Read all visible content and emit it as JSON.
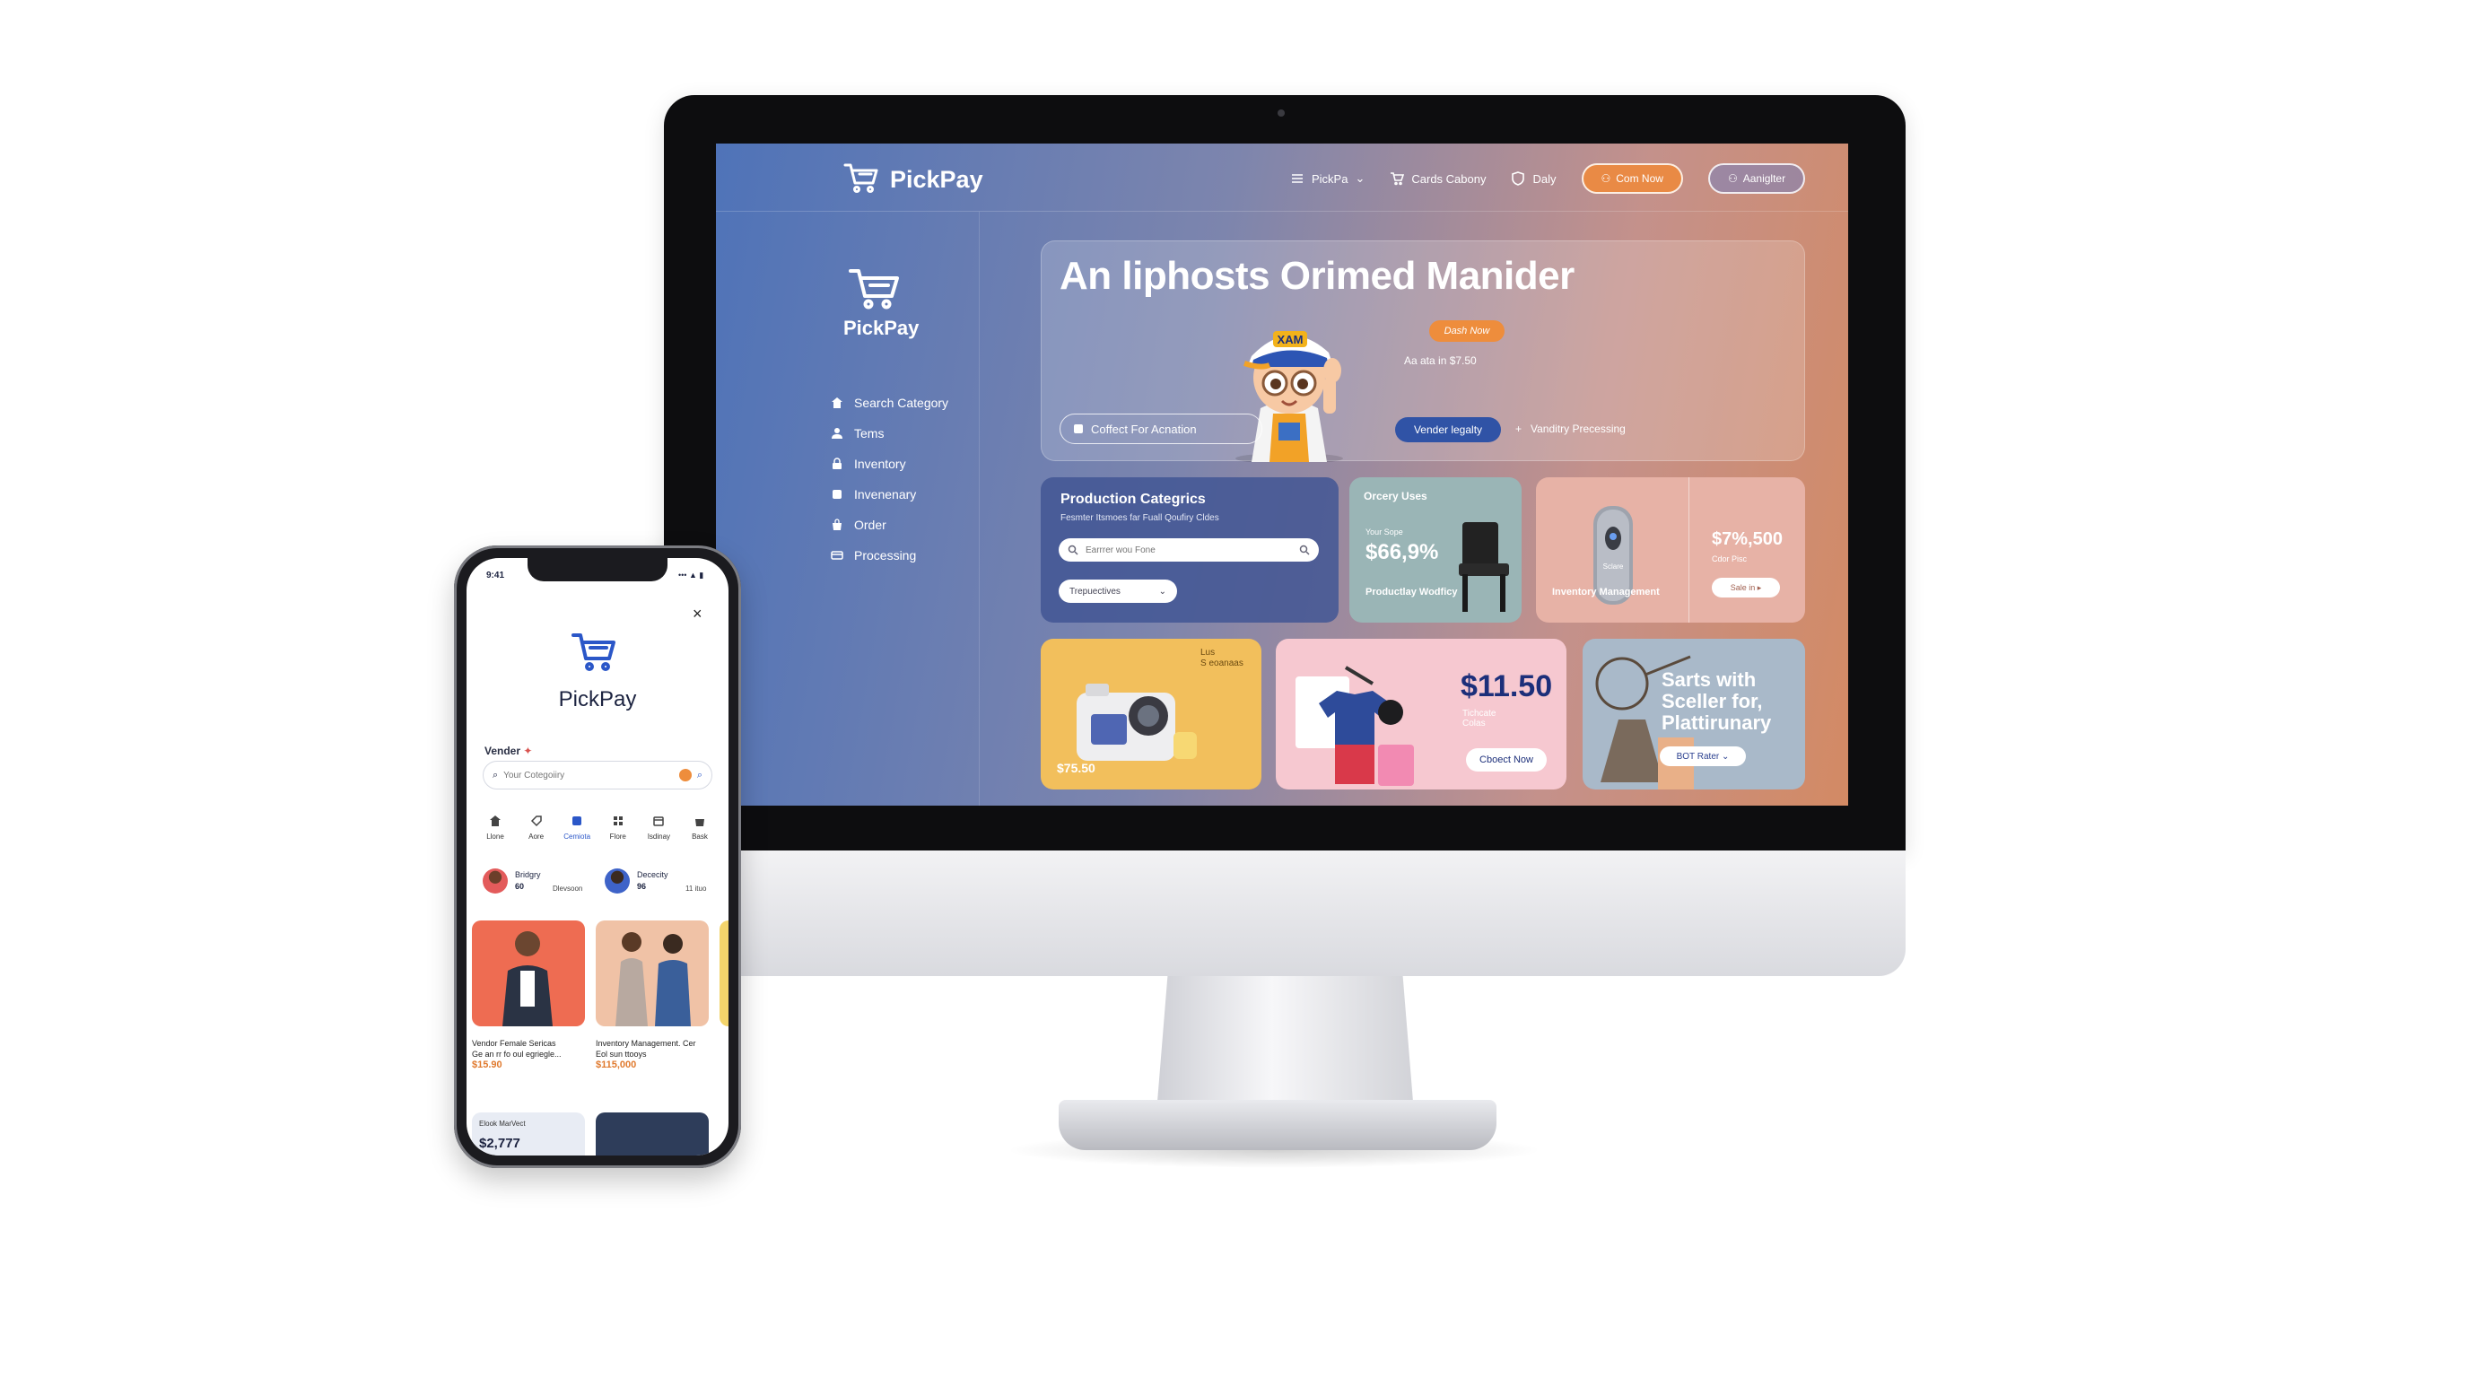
{
  "colors": {
    "accent_orange": "#ee8d3c",
    "accent_blue": "#3053a6",
    "brand_navy": "#1c2f7a",
    "screen_left": "#4f73b8",
    "screen_right": "#d38a64"
  },
  "desktop": {
    "brand": {
      "name": "PickPay",
      "icon": "cart-icon"
    },
    "nav": {
      "items": [
        {
          "label": "PickPa",
          "icon": "menu-icon"
        },
        {
          "label": "Cards Cabony",
          "icon": "cart-icon"
        },
        {
          "label": "Daly",
          "icon": "shield-icon"
        }
      ],
      "primary_button": "Com Now",
      "secondary_button": "Aaniglter"
    },
    "sidebar": {
      "brand": "PickPay",
      "items": [
        {
          "label": "Search Category",
          "icon": "home-icon"
        },
        {
          "label": "Tems",
          "icon": "user-icon"
        },
        {
          "label": "Inventory",
          "icon": "lock-icon"
        },
        {
          "label": "Invenenary",
          "icon": "box-icon"
        },
        {
          "label": "Order",
          "icon": "bag-icon"
        },
        {
          "label": "Processing",
          "icon": "card-icon"
        }
      ]
    },
    "hero": {
      "title": "An liphosts Orimed Manider",
      "badge": "Dash Now",
      "price_text": "Aa ata in $7.50",
      "pill_label": "Coffect For Acnation",
      "vendor_button": "Vender legalty",
      "link_label": "Vanditry Precessing"
    },
    "category_card": {
      "title": "Production Categrics",
      "subtitle": "Fesmter Itsmoes far Fuall Qoufiry Cldes",
      "search_placeholder": "Earrrer wou Fone",
      "select_value": "Trepuectives"
    },
    "grocery_card": {
      "title": "Orcery Uses",
      "small": "Your Sope",
      "value": "$66,9%",
      "footer": "Productlay Wodficy"
    },
    "inventory_card": {
      "label": "Inventory Management",
      "device_label": "Sclare",
      "value": "$7%,500",
      "sub": "Cdor Pisc",
      "button": "Sale in ▸"
    },
    "camera_card": {
      "badge": "Lus\nS eoanaas",
      "price": "$75.50"
    },
    "clothing_card": {
      "price": "$11.50",
      "sub": "Tichcate\nColas",
      "button": "Cboect Now"
    },
    "seller_card": {
      "text": "Sarts with\nSceller for,\nPlattirunary",
      "button": "BOT Rater ⌄"
    }
  },
  "mobile": {
    "status_time": "9:41",
    "status_icons": "••• ▲ ▮",
    "close_icon": "×",
    "brand": "PickPay",
    "vendor_label": "Vender",
    "search_placeholder": "Your Cotegoiiry",
    "tabs": [
      {
        "label": "Llone",
        "icon": "home-icon",
        "active": false
      },
      {
        "label": "Aore",
        "icon": "tag-icon",
        "active": false
      },
      {
        "label": "Cemiota",
        "icon": "chart-icon",
        "active": true
      },
      {
        "label": "Flore",
        "icon": "grid-icon",
        "active": false
      },
      {
        "label": "Isdinay",
        "icon": "calendar-icon",
        "active": false
      },
      {
        "label": "Bask",
        "icon": "bag-icon",
        "active": false
      }
    ],
    "people": [
      {
        "name": "Bridgry",
        "count": "60",
        "meta": "Dlevsoon"
      },
      {
        "name": "Dececity",
        "count": "96",
        "meta": "11 ituo"
      }
    ],
    "products": [
      {
        "title": "Vendor Female Sericas\nGe an rr fo oul egriegle...",
        "price": "$15.90"
      },
      {
        "title": "Inventory Management. Cer\nEol sun ttooys",
        "price": "$115,000"
      }
    ],
    "bottom_card": {
      "title": "Elook MarVect",
      "price": "$2,777"
    }
  }
}
